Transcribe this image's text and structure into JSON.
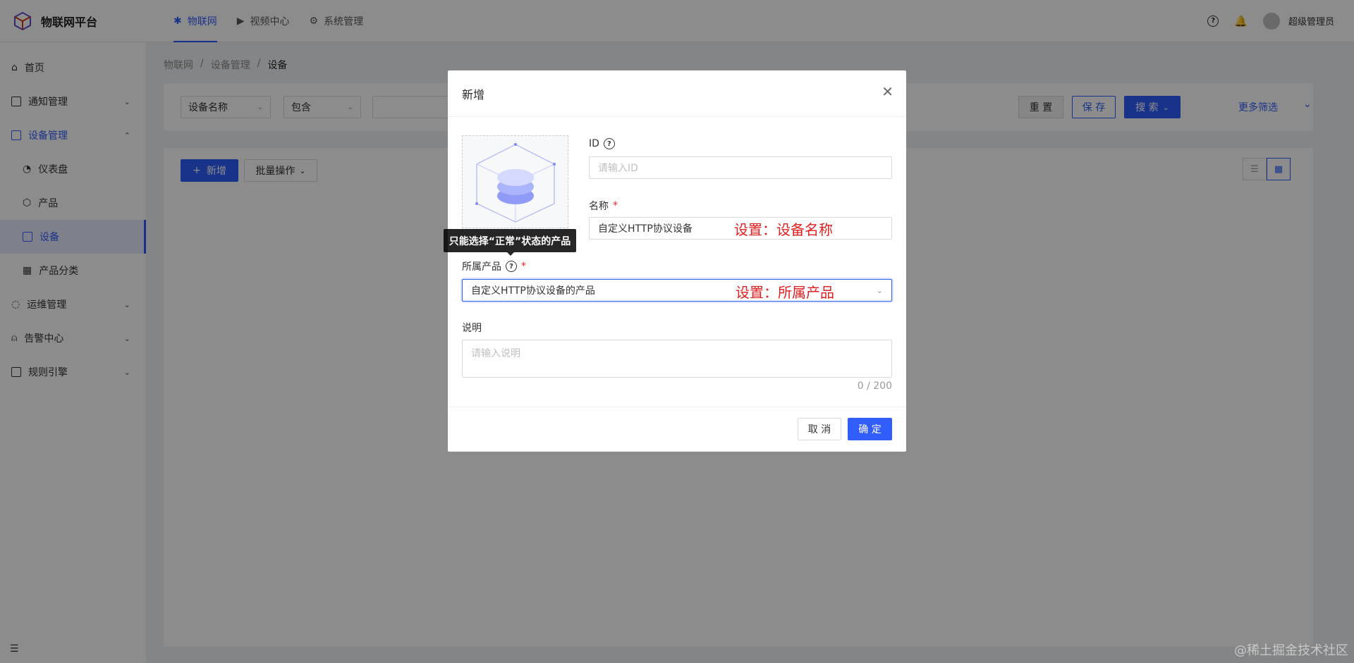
{
  "app": {
    "title": "物联网平台"
  },
  "topnav": [
    {
      "label": "物联网",
      "icon": "iot-icon",
      "active": true
    },
    {
      "label": "视频中心",
      "icon": "video-icon"
    },
    {
      "label": "系统管理",
      "icon": "settings-icon"
    }
  ],
  "user": {
    "name": "超级管理员"
  },
  "sidebar": {
    "items": [
      {
        "label": "首页",
        "icon": "home-icon"
      },
      {
        "label": "通知管理",
        "icon": "notification-icon"
      },
      {
        "label": "设备管理",
        "icon": "device-icon"
      },
      {
        "label": "仪表盘",
        "icon": "dashboard-icon"
      },
      {
        "label": "产品",
        "icon": "product-icon"
      },
      {
        "label": "设备",
        "icon": "device-list-icon"
      },
      {
        "label": "产品分类",
        "icon": "category-icon"
      },
      {
        "label": "运维管理",
        "icon": "ops-icon"
      },
      {
        "label": "告警中心",
        "icon": "alarm-icon"
      },
      {
        "label": "规则引擎",
        "icon": "rule-icon"
      }
    ]
  },
  "breadcrumb": [
    "物联网",
    "设备管理",
    "设备"
  ],
  "filter": {
    "field": "设备名称",
    "operator": "包含",
    "reset_label": "重 置",
    "save_label": "保 存",
    "search_label": "搜 索",
    "more_label": "更多筛选"
  },
  "toolbar": {
    "add_label": "新增",
    "batch_label": "批量操作"
  },
  "modal": {
    "title": "新增",
    "id_label": "ID",
    "id_placeholder": "请输入ID",
    "name_label": "名称",
    "name_value": "自定义HTTP协议设备",
    "product_label": "所属产品",
    "product_value": "自定义HTTP协议设备的产品",
    "desc_label": "说明",
    "desc_placeholder": "请输入说明",
    "desc_counter": "0 / 200",
    "cancel_label": "取 消",
    "ok_label": "确 定",
    "tooltip": "只能选择“正常”状态的产品"
  },
  "annotations": {
    "name": "设置：设备名称",
    "product": "设置：所属产品"
  },
  "watermark": "@稀土掘金技术社区",
  "colors": {
    "primary": "#315efb",
    "annotation": "#e02020"
  }
}
